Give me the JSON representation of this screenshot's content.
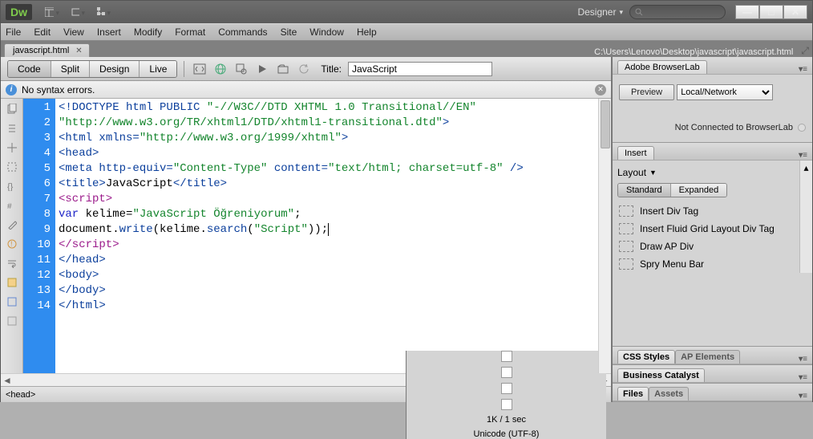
{
  "app": {
    "logo": "Dw",
    "workspace": "Designer"
  },
  "window_buttons": {
    "min": "—",
    "max": "□",
    "close": "✕"
  },
  "menu": [
    "File",
    "Edit",
    "View",
    "Insert",
    "Modify",
    "Format",
    "Commands",
    "Site",
    "Window",
    "Help"
  ],
  "document": {
    "tab_name": "javascript.html",
    "path": "C:\\Users\\Lenovo\\Desktop\\javascript\\javascript.html"
  },
  "view_buttons": {
    "code": "Code",
    "split": "Split",
    "design": "Design",
    "live": "Live"
  },
  "title_field": {
    "label": "Title:",
    "value": "JavaScript"
  },
  "syntax_bar": {
    "message": "No syntax errors."
  },
  "line_numbers": [
    "1",
    "2",
    "3",
    "4",
    "5",
    "6",
    "7",
    "8",
    "9",
    "10",
    "11",
    "12",
    "13",
    "14"
  ],
  "code": {
    "l1a": "<!DOCTYPE html PUBLIC ",
    "l1b": "\"-//W3C//DTD XHTML 1.0 Transitional//EN\"",
    "l1c": "\"http://www.w3.org/TR/xhtml1/DTD/xhtml1-transitional.dtd\"",
    "l1d": ">",
    "l2a": "<html ",
    "l2b": "xmlns=",
    "l2c": "\"http://www.w3.org/1999/xhtml\"",
    "l2d": ">",
    "l3": "<head>",
    "l4a": "<meta ",
    "l4b": "http-equiv=",
    "l4c": "\"Content-Type\"",
    "l4d": " content=",
    "l4e": "\"text/html; charset=utf-8\"",
    "l4f": " />",
    "l5a": "<title>",
    "l5b": "JavaScript",
    "l5c": "</title>",
    "l6": "<script>",
    "l7a": "var",
    "l7b": " kelime=",
    "l7c": "\"JavaScript Öğreniyorum\"",
    "l7d": ";",
    "l8a": "document",
    "l8b": ".",
    "l8c": "write",
    "l8d": "(kelime.",
    "l8e": "search",
    "l8f": "(",
    "l8g": "\"Script\"",
    "l8h": "));",
    "l9": "</script>",
    "l10": "</head>",
    "l11": "<body>",
    "l12": "</body>",
    "l13": "</html>"
  },
  "status": {
    "left": "<head>",
    "size": "1K / 1 sec",
    "encoding": "Unicode (UTF-8)"
  },
  "panels": {
    "browserlab": {
      "title": "Adobe BrowserLab",
      "preview": "Preview",
      "network": "Local/Network",
      "status": "Not Connected to BrowserLab"
    },
    "insert": {
      "title": "Insert",
      "category": "Layout",
      "seg": {
        "standard": "Standard",
        "expanded": "Expanded"
      },
      "items": [
        "Insert Div Tag",
        "Insert Fluid Grid Layout Div Tag",
        "Draw AP Div",
        "Spry Menu Bar"
      ]
    },
    "css": {
      "tab1": "CSS Styles",
      "tab2": "AP Elements"
    },
    "bc": {
      "title": "Business Catalyst"
    },
    "files": {
      "tab1": "Files",
      "tab2": "Assets"
    }
  }
}
